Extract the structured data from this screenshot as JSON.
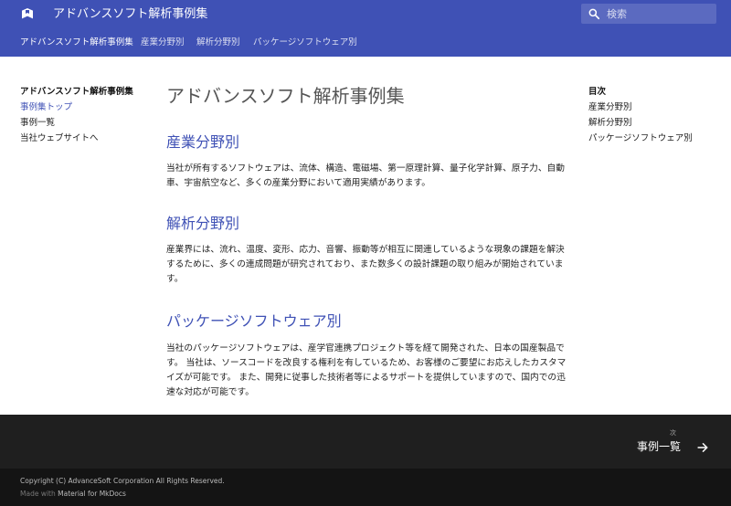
{
  "header": {
    "site_title": "アドバンスソフト解析事例集",
    "search_placeholder": "検索"
  },
  "tabs": [
    {
      "label": "アドバンスソフト解析事例集",
      "active": true
    },
    {
      "label": "産業分野別",
      "active": false
    },
    {
      "label": "解析分野別",
      "active": false
    },
    {
      "label": "パッケージソフトウェア別",
      "active": false
    }
  ],
  "nav": {
    "title": "アドバンスソフト解析事例集",
    "items": [
      {
        "label": "事例集トップ",
        "active": true
      },
      {
        "label": "事例一覧",
        "active": false
      },
      {
        "label": "当社ウェブサイトへ",
        "active": false
      }
    ]
  },
  "toc": {
    "title": "目次",
    "items": [
      {
        "label": "産業分野別"
      },
      {
        "label": "解析分野別"
      },
      {
        "label": "パッケージソフトウェア別"
      }
    ]
  },
  "main": {
    "title": "アドバンスソフト解析事例集",
    "sections": [
      {
        "heading": "産業分野別",
        "text": "当社が所有するソフトウェアは、流体、構造、電磁場、第一原理計算、量子化学計算、原子力、自動車、宇宙航空など、多くの産業分野において適用実績があります。"
      },
      {
        "heading": "解析分野別",
        "text": "産業界には、流れ、温度、変形、応力、音響、振動等が相互に関連しているような現象の課題を解決するために、多くの連成問題が研究されており、また数多くの設計課題の取り組みが開始されています。"
      },
      {
        "heading": "パッケージソフトウェア別",
        "text": "当社のパッケージソフトウェアは、産学官連携プロジェクト等を経て開発された、日本の国産製品です。 当社は、ソースコードを改良する権利を有しているため、お客様のご要望にお応えしたカスタマイズが可能です。 また、開発に従事した技術者等によるサポートを提供していますので、国内での迅速な対応が可能です。"
      }
    ]
  },
  "footer": {
    "next_label": "次",
    "next_title": "事例一覧",
    "copyright": "Copyright (C) AdvanceSoft Corporation All Rights Reserved.",
    "made_with_prefix": "Made with",
    "made_with_link": "Material for MkDocs"
  },
  "colors": {
    "primary": "#3f51b5",
    "footer_dark": "#1f1f1f",
    "footer_darker": "#141414"
  },
  "icons": {
    "logo": "book-icon",
    "search": "search-icon",
    "next": "arrow-right-icon"
  }
}
